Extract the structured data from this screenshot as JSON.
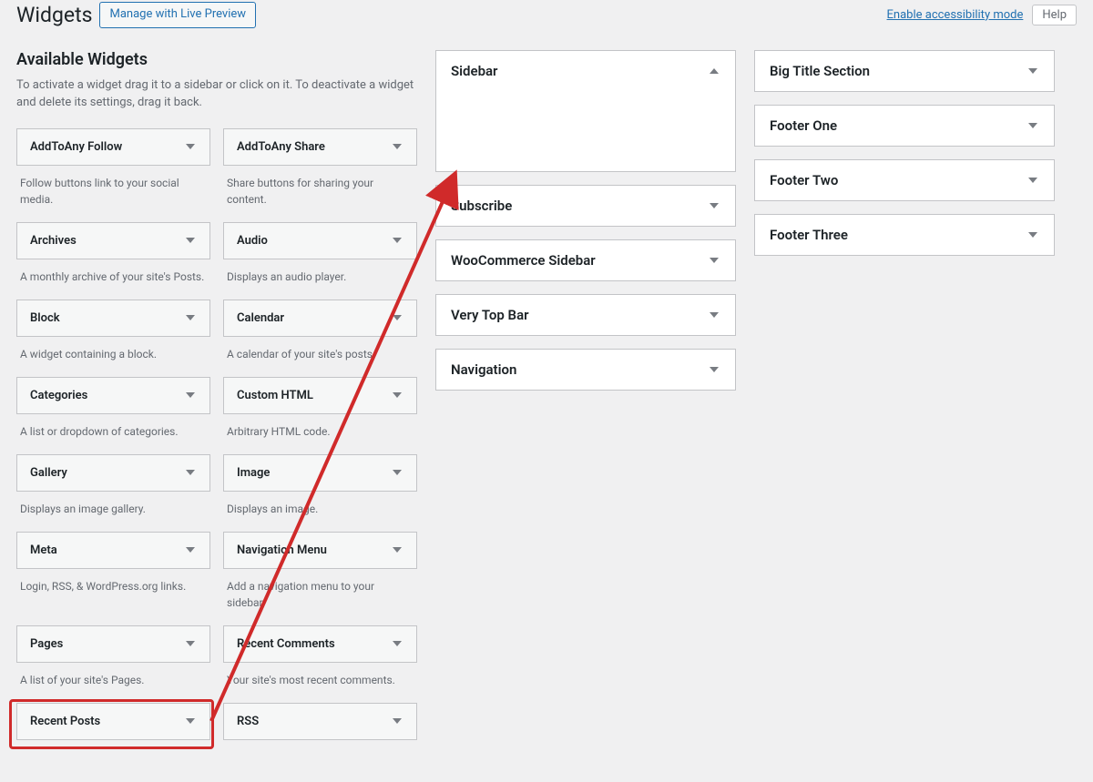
{
  "header": {
    "title": "Widgets",
    "manage_label": "Manage with Live Preview",
    "accessibility_link": "Enable accessibility mode",
    "help_label": "Help"
  },
  "section": {
    "title": "Available Widgets",
    "help": "To activate a widget drag it to a sidebar or click on it. To deactivate a widget and delete its settings, drag it back."
  },
  "widgets": [
    {
      "name": "AddToAny Follow",
      "desc": "Follow buttons link to your social media."
    },
    {
      "name": "AddToAny Share",
      "desc": "Share buttons for sharing your content."
    },
    {
      "name": "Archives",
      "desc": "A monthly archive of your site's Posts."
    },
    {
      "name": "Audio",
      "desc": "Displays an audio player."
    },
    {
      "name": "Block",
      "desc": "A widget containing a block."
    },
    {
      "name": "Calendar",
      "desc": "A calendar of your site's posts."
    },
    {
      "name": "Categories",
      "desc": "A list or dropdown of categories."
    },
    {
      "name": "Custom HTML",
      "desc": "Arbitrary HTML code."
    },
    {
      "name": "Gallery",
      "desc": "Displays an image gallery."
    },
    {
      "name": "Image",
      "desc": "Displays an image."
    },
    {
      "name": "Meta",
      "desc": "Login, RSS, & WordPress.org links."
    },
    {
      "name": "Navigation Menu",
      "desc": "Add a navigation menu to your sidebar."
    },
    {
      "name": "Pages",
      "desc": "A list of your site's Pages."
    },
    {
      "name": "Recent Comments",
      "desc": "Your site's most recent comments."
    },
    {
      "name": "Recent Posts",
      "desc": ""
    },
    {
      "name": "RSS",
      "desc": ""
    }
  ],
  "areas_mid": [
    {
      "name": "Sidebar",
      "expanded": true
    },
    {
      "name": "Subscribe",
      "expanded": false
    },
    {
      "name": "WooCommerce Sidebar",
      "expanded": false
    },
    {
      "name": "Very Top Bar",
      "expanded": false
    },
    {
      "name": "Navigation",
      "expanded": false
    }
  ],
  "areas_right": [
    {
      "name": "Big Title Section",
      "expanded": false
    },
    {
      "name": "Footer One",
      "expanded": false
    },
    {
      "name": "Footer Two",
      "expanded": false
    },
    {
      "name": "Footer Three",
      "expanded": false
    }
  ]
}
